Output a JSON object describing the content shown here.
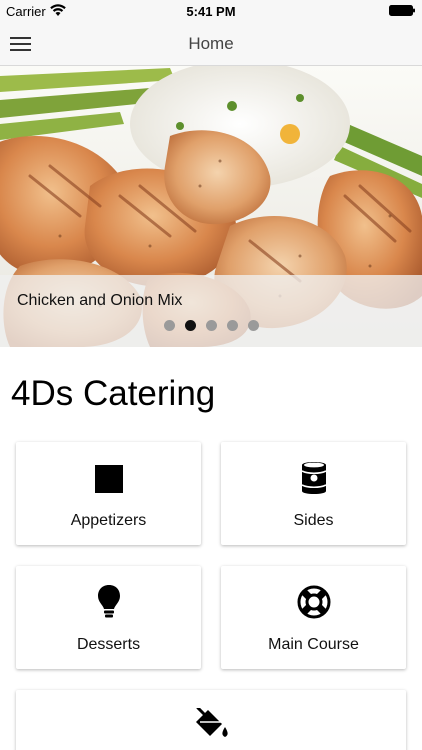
{
  "status_bar": {
    "carrier": "Carrier",
    "time": "5:41 PM"
  },
  "nav": {
    "title": "Home",
    "menu_icon": "hamburger-menu-icon"
  },
  "hero": {
    "caption": "Chicken and Onion Mix",
    "page_count": 5,
    "active_page": 2
  },
  "page": {
    "title": "4Ds Catering"
  },
  "categories": [
    {
      "label": "Appetizers",
      "icon": "square-icon"
    },
    {
      "label": "Sides",
      "icon": "can-icon"
    },
    {
      "label": "Desserts",
      "icon": "lightbulb-icon"
    },
    {
      "label": "Main Course",
      "icon": "life-ring-icon"
    },
    {
      "label": "",
      "icon": "paint-bucket-icon"
    }
  ]
}
